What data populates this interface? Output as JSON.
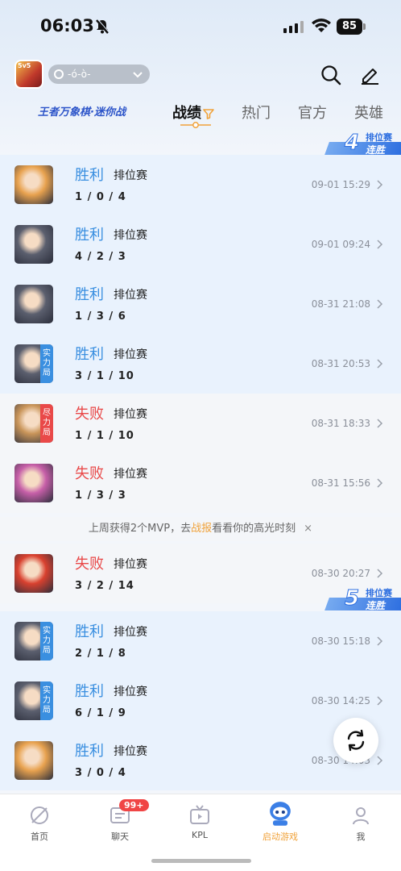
{
  "status_bar": {
    "time": "06:03",
    "battery": "85"
  },
  "header": {
    "account_name": "-ó-ò-"
  },
  "banner": {
    "text": "王者万象棋·迷你战"
  },
  "tabs": [
    {
      "label": "战绩",
      "active": true
    },
    {
      "label": "热门"
    },
    {
      "label": "官方"
    },
    {
      "label": "英雄"
    }
  ],
  "streaks": [
    {
      "count": "4",
      "label_top": "排位赛",
      "label_bottom": "连胜"
    },
    {
      "count": "5",
      "label_top": "排位赛",
      "label_bottom": "连胜"
    }
  ],
  "matches": [
    {
      "result": "胜利",
      "outcome": "win",
      "mode": "排位赛",
      "kda": "1 / 0 / 4",
      "time": "09-01 15:29",
      "tag": "",
      "hero_color": "#e8a24f"
    },
    {
      "result": "胜利",
      "outcome": "win",
      "mode": "排位赛",
      "kda": "4 / 2 / 3",
      "time": "09-01 09:24",
      "tag": "",
      "hero_color": "#5b5f6e"
    },
    {
      "result": "胜利",
      "outcome": "win",
      "mode": "排位赛",
      "kda": "1 / 3 / 6",
      "time": "08-31 21:08",
      "tag": "",
      "hero_color": "#5b5f6e"
    },
    {
      "result": "胜利",
      "outcome": "win",
      "mode": "排位赛",
      "kda": "3 / 1 / 10",
      "time": "08-31 20:53",
      "tag": "实力局",
      "tag_color": "#3a8fe0",
      "hero_color": "#5b5f6e"
    },
    {
      "result": "失败",
      "outcome": "loss",
      "mode": "排位赛",
      "kda": "1 / 1 / 10",
      "time": "08-31 18:33",
      "tag": "尽力局",
      "tag_color": "#e94949",
      "hero_color": "#c9955a"
    },
    {
      "result": "失败",
      "outcome": "loss",
      "mode": "排位赛",
      "kda": "1 / 3 / 3",
      "time": "08-31 15:56",
      "tag": "",
      "hero_color": "#c65fa8"
    },
    {
      "result": "失败",
      "outcome": "loss",
      "mode": "排位赛",
      "kda": "3 / 2 / 14",
      "time": "08-30 20:27",
      "tag": "",
      "hero_color": "#d9412f"
    },
    {
      "result": "胜利",
      "outcome": "win",
      "mode": "排位赛",
      "kda": "2 / 1 / 8",
      "time": "08-30 15:18",
      "tag": "实力局",
      "tag_color": "#3a8fe0",
      "hero_color": "#5b5f6e"
    },
    {
      "result": "胜利",
      "outcome": "win",
      "mode": "排位赛",
      "kda": "6 / 1 / 9",
      "time": "08-30 14:25",
      "tag": "实力局",
      "tag_color": "#3a8fe0",
      "hero_color": "#5b5f6e"
    },
    {
      "result": "胜利",
      "outcome": "win",
      "mode": "排位赛",
      "kda": "3 / 0 / 4",
      "time": "08-30 14:03",
      "tag": "",
      "hero_color": "#e8a24f"
    }
  ],
  "mvp_tip": {
    "before": "上周获得2个MVP，去",
    "highlight": "战报",
    "after": "看看你的高光时刻",
    "close": "×"
  },
  "bottom_nav": [
    {
      "label": "首页",
      "icon": "home-icon"
    },
    {
      "label": "聊天",
      "icon": "chat-icon",
      "badge": "99+"
    },
    {
      "label": "KPL",
      "icon": "tv-icon"
    },
    {
      "label": "启动游戏",
      "icon": "launch-game-icon",
      "active": true
    },
    {
      "label": "我",
      "icon": "profile-icon"
    }
  ],
  "colors": {
    "win": "#3a8fe0",
    "loss": "#e94949",
    "accent": "#f0a23a",
    "brand_blue": "#2e6fe0"
  }
}
